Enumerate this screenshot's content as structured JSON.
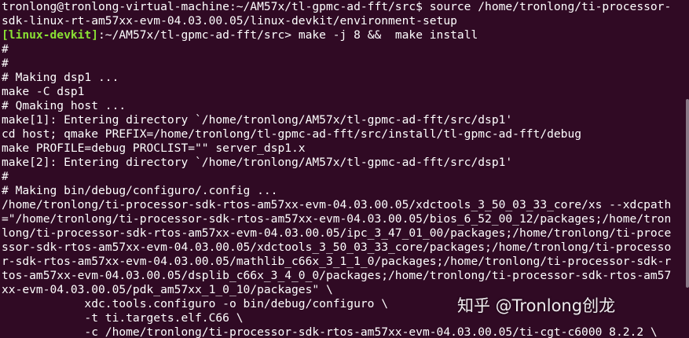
{
  "terminal": {
    "lines": [
      "tronlong@tronlong-virtual-machine:~/AM57x/tl-gpmc-ad-fft/src$ source /home/tronlong/ti-processor-",
      "sdk-linux-rt-am57xx-evm-04.03.00.05/linux-devkit/environment-setup",
      "",
      "#",
      "#",
      "# Making dsp1 ...",
      "make -C dsp1",
      "# Qmaking host ...",
      "make[1]: Entering directory `/home/tronlong/AM57x/tl-gpmc-ad-fft/src/dsp1'",
      "cd host; qmake PREFIX=/home/tronlong/tl-gpmc-ad-fft/src/install/tl-gpmc-ad-fft/debug",
      "make PROFILE=debug PROCLIST=\"\" server_dsp1.x",
      "make[2]: Entering directory `/home/tronlong/AM57x/tl-gpmc-ad-fft/src/dsp1'",
      "#",
      "# Making bin/debug/configuro/.config ...",
      "/home/tronlong/ti-processor-sdk-rtos-am57xx-evm-04.03.00.05/xdctools_3_50_03_33_core/xs --xdcpath",
      "=\"/home/tronlong/ti-processor-sdk-rtos-am57xx-evm-04.03.00.05/bios_6_52_00_12/packages;/home/tron",
      "long/ti-processor-sdk-rtos-am57xx-evm-04.03.00.05/ipc_3_47_01_00/packages;/home/tronlong/ti-proce",
      "ssor-sdk-rtos-am57xx-evm-04.03.00.05/xdctools_3_50_03_33_core/packages;/home/tronlong/ti-processo",
      "r-sdk-rtos-am57xx-evm-04.03.00.05/mathlib_c66x_3_1_1_0/packages;/home/tronlong/ti-processor-sdk-r",
      "tos-am57xx-evm-04.03.00.05/dsplib_c66x_3_4_0_0/packages;/home/tronlong/ti-processor-sdk-rtos-am57",
      "xx-evm-04.03.00.05/pdk_am57xx_1_0_10/packages\" \\",
      "            xdc.tools.configuro -o bin/debug/configuro \\",
      "            -t ti.targets.elf.C66 \\",
      "            -c /home/tronlong/ti-processor-sdk-rtos-am57xx-evm-04.03.00.05/ti-cgt-c6000_8.2.2 \\"
    ],
    "prompt": {
      "label": "[linux-devkit]",
      "path": ":~/AM57x/tl-gpmc-ad-fft/src> ",
      "command": "make -j 8 &&  make install"
    }
  },
  "watermark": {
    "text": "知乎 @Tronlong创龙"
  },
  "colors": {
    "background": "#300a24",
    "text": "#ffffff",
    "prompt_label": "#8ae234"
  }
}
